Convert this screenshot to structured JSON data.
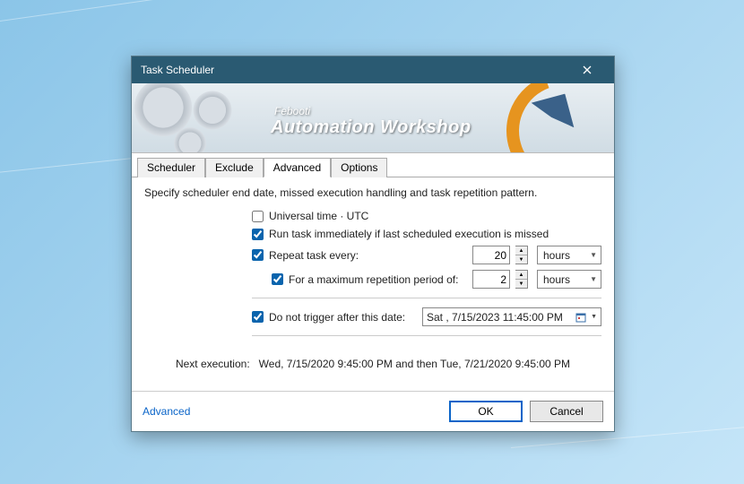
{
  "window": {
    "title": "Task Scheduler"
  },
  "banner": {
    "brand": "Febooti",
    "product": "Automation Workshop"
  },
  "tabs": [
    "Scheduler",
    "Exclude",
    "Advanced",
    "Options"
  ],
  "active_tab": "Advanced",
  "description": "Specify scheduler end date, missed execution handling and task repetition pattern.",
  "opts": {
    "utc_label": "Universal time · UTC",
    "utc_checked": false,
    "run_missed_label": "Run task immediately if last scheduled execution is missed",
    "run_missed_checked": true,
    "repeat_label": "Repeat task every:",
    "repeat_checked": true,
    "repeat_value": "20",
    "repeat_unit": "hours",
    "max_period_label": "For a maximum repetition period of:",
    "max_period_checked": true,
    "max_period_value": "2",
    "max_period_unit": "hours",
    "stop_after_label": "Do not trigger after this date:",
    "stop_after_checked": true,
    "stop_after_date": "Sat ,   7/15/2023 11:45:00 PM"
  },
  "next_execution": {
    "label": "Next execution:",
    "value": "Wed, 7/15/2020 9:45:00 PM and then Tue, 7/21/2020 9:45:00 PM"
  },
  "footer": {
    "link": "Advanced",
    "ok": "OK",
    "cancel": "Cancel"
  }
}
